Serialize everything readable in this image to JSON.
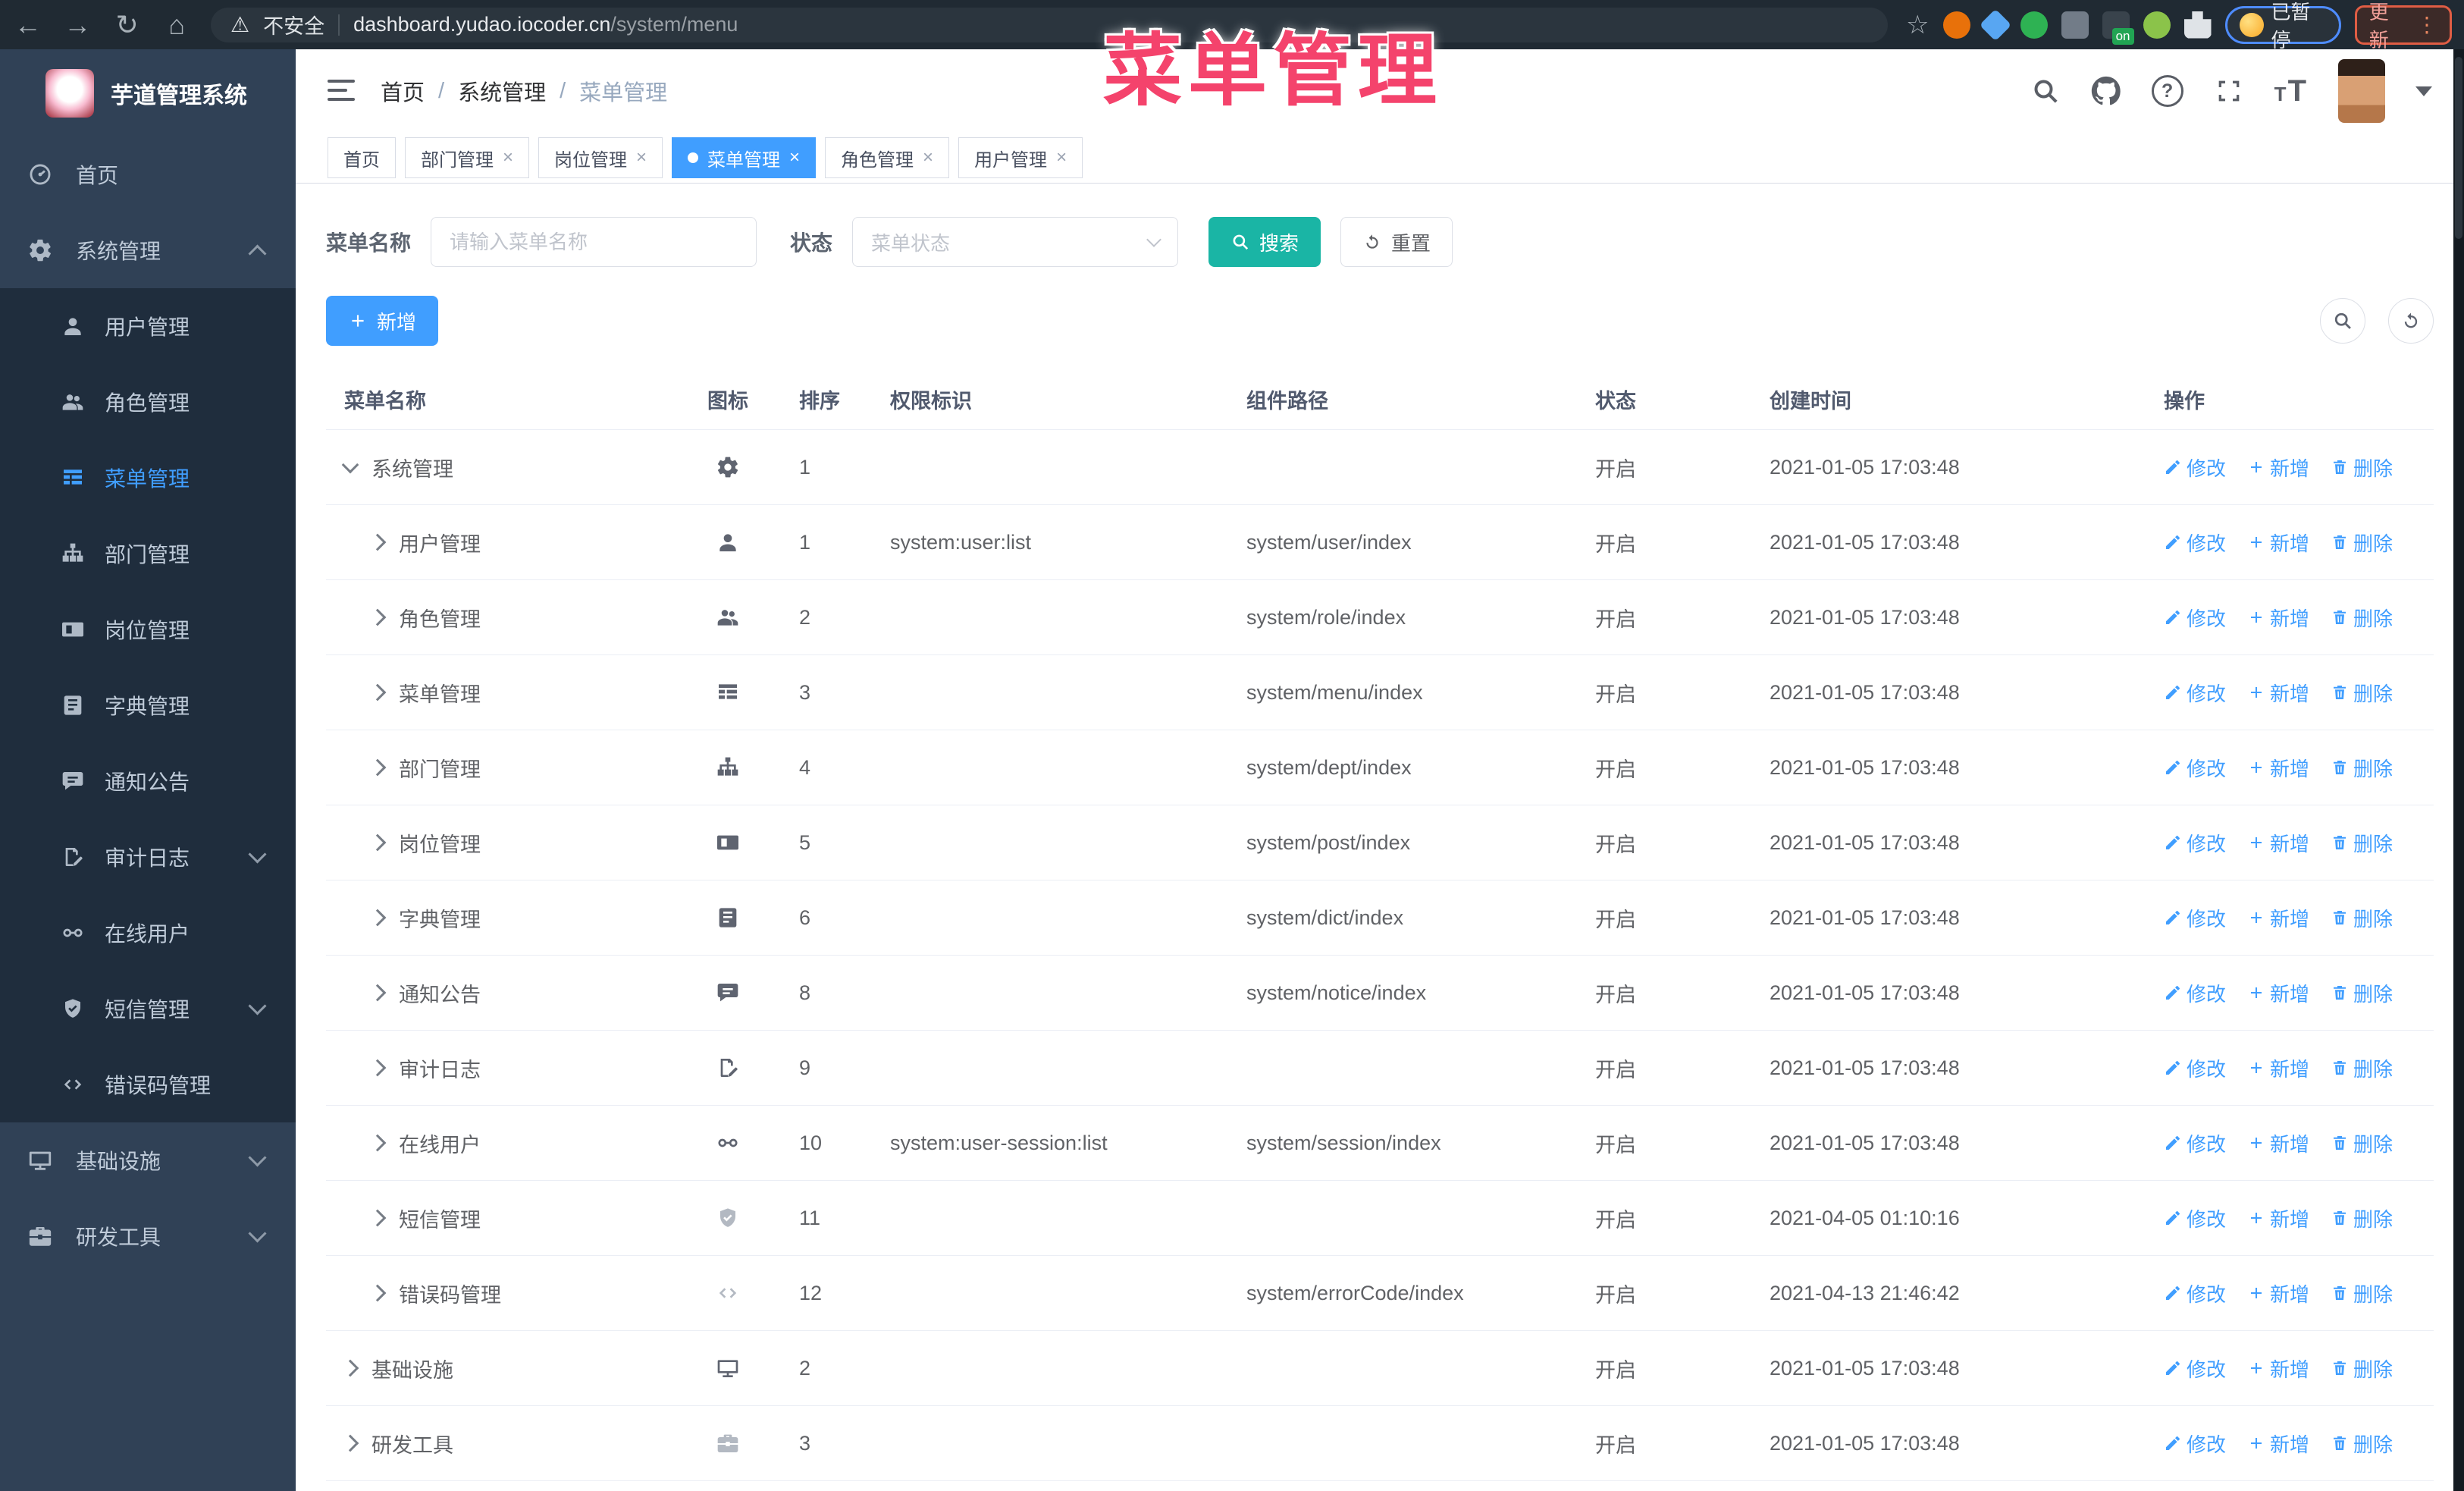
{
  "overlay": {
    "title": "菜单管理"
  },
  "colors": {
    "primary": "#409eff",
    "search_button": "#1ab5a5",
    "annotation": "#f4436c",
    "sidebar_bg": "#304156",
    "submenu_bg": "#1f2d3d",
    "tab_active": "#409eff"
  },
  "browser": {
    "security_label": "不安全",
    "url_host": "dashboard.yudao.iocoder.cn",
    "url_path": "/system/menu",
    "paused_label": "已暂停",
    "update_label": "更新",
    "extensions": [
      {
        "icon": "circle-orange",
        "shape": "c",
        "color": "#e8710a"
      },
      {
        "icon": "gem-blue",
        "shape": "d",
        "color": "#58a6f2"
      },
      {
        "icon": "circle-green-check",
        "shape": "c",
        "color": "#2eb253"
      },
      {
        "icon": "blocks-gray",
        "shape": "sq",
        "color": "#727c88"
      },
      {
        "icon": "panel-dark",
        "shape": "sq",
        "color": "#39434c",
        "badge": "on",
        "badge_color": "#21a453"
      },
      {
        "icon": "robot-green",
        "shape": "c",
        "color": "#8bc34a"
      },
      {
        "icon": "extensions-puzzle",
        "shape": "p",
        "color": "#dfe3e7"
      }
    ]
  },
  "sidebar": {
    "logo_title": "芋道管理系统",
    "items": [
      {
        "label": "首页",
        "icon": "dashboard",
        "type": "root"
      },
      {
        "label": "系统管理",
        "icon": "gear",
        "type": "root",
        "caret": "up"
      },
      {
        "label": "用户管理",
        "icon": "user",
        "type": "sub"
      },
      {
        "label": "角色管理",
        "icon": "users",
        "type": "sub"
      },
      {
        "label": "菜单管理",
        "icon": "menu",
        "type": "sub",
        "active": true
      },
      {
        "label": "部门管理",
        "icon": "tree",
        "type": "sub"
      },
      {
        "label": "岗位管理",
        "icon": "badge",
        "type": "sub"
      },
      {
        "label": "字典管理",
        "icon": "book",
        "type": "sub"
      },
      {
        "label": "通知公告",
        "icon": "chat",
        "type": "sub"
      },
      {
        "label": "审计日志",
        "icon": "edit",
        "type": "sub",
        "caret": "down"
      },
      {
        "label": "在线用户",
        "icon": "link",
        "type": "sub"
      },
      {
        "label": "短信管理",
        "icon": "shield",
        "type": "sub",
        "caret": "down"
      },
      {
        "label": "错误码管理",
        "icon": "code",
        "type": "sub"
      },
      {
        "label": "基础设施",
        "icon": "monitor",
        "type": "root",
        "caret": "down"
      },
      {
        "label": "研发工具",
        "icon": "toolbox",
        "type": "root",
        "caret": "down"
      }
    ]
  },
  "header": {
    "breadcrumb": [
      "首页",
      "系统管理",
      "菜单管理"
    ],
    "breadcrumb_separator": "/"
  },
  "tabs_close_glyph": "×",
  "tabs": [
    {
      "label": "首页",
      "closable": false,
      "active": false
    },
    {
      "label": "部门管理",
      "closable": true,
      "active": false
    },
    {
      "label": "岗位管理",
      "closable": true,
      "active": false
    },
    {
      "label": "菜单管理",
      "closable": true,
      "active": true
    },
    {
      "label": "角色管理",
      "closable": true,
      "active": false
    },
    {
      "label": "用户管理",
      "closable": true,
      "active": false
    }
  ],
  "filters": {
    "name_label": "菜单名称",
    "name_placeholder": "请输入菜单名称",
    "status_label": "状态",
    "status_placeholder": "菜单状态",
    "search_label": "搜索",
    "reset_label": "重置"
  },
  "toolbar": {
    "add_label": "新增"
  },
  "table": {
    "columns": [
      "菜单名称",
      "图标",
      "排序",
      "权限标识",
      "组件路径",
      "状态",
      "创建时间",
      "操作"
    ],
    "actions": [
      {
        "label": "修改",
        "icon": "pen"
      },
      {
        "label": "新增",
        "icon": "plus"
      },
      {
        "label": "删除",
        "icon": "trash"
      }
    ],
    "rows": [
      {
        "name": "系统管理",
        "level": 0,
        "expand": "open",
        "icon": "gear",
        "sort": "1",
        "perm": "",
        "path": "",
        "status": "开启",
        "time": "2021-01-05 17:03:48"
      },
      {
        "name": "用户管理",
        "level": 1,
        "expand": "closed",
        "icon": "user",
        "sort": "1",
        "perm": "system:user:list",
        "path": "system/user/index",
        "status": "开启",
        "time": "2021-01-05 17:03:48"
      },
      {
        "name": "角色管理",
        "level": 1,
        "expand": "closed",
        "icon": "users",
        "sort": "2",
        "perm": "",
        "path": "system/role/index",
        "status": "开启",
        "time": "2021-01-05 17:03:48"
      },
      {
        "name": "菜单管理",
        "level": 1,
        "expand": "closed",
        "icon": "menu",
        "sort": "3",
        "perm": "",
        "path": "system/menu/index",
        "status": "开启",
        "time": "2021-01-05 17:03:48"
      },
      {
        "name": "部门管理",
        "level": 1,
        "expand": "closed",
        "icon": "tree",
        "sort": "4",
        "perm": "",
        "path": "system/dept/index",
        "status": "开启",
        "time": "2021-01-05 17:03:48"
      },
      {
        "name": "岗位管理",
        "level": 1,
        "expand": "closed",
        "icon": "badge",
        "sort": "5",
        "perm": "",
        "path": "system/post/index",
        "status": "开启",
        "time": "2021-01-05 17:03:48"
      },
      {
        "name": "字典管理",
        "level": 1,
        "expand": "closed",
        "icon": "book",
        "sort": "6",
        "perm": "",
        "path": "system/dict/index",
        "status": "开启",
        "time": "2021-01-05 17:03:48"
      },
      {
        "name": "通知公告",
        "level": 1,
        "expand": "closed",
        "icon": "chat",
        "sort": "8",
        "perm": "",
        "path": "system/notice/index",
        "status": "开启",
        "time": "2021-01-05 17:03:48"
      },
      {
        "name": "审计日志",
        "level": 1,
        "expand": "closed",
        "icon": "edit",
        "sort": "9",
        "perm": "",
        "path": "",
        "status": "开启",
        "time": "2021-01-05 17:03:48"
      },
      {
        "name": "在线用户",
        "level": 1,
        "expand": "closed",
        "icon": "link",
        "sort": "10",
        "perm": "system:user-session:list",
        "path": "system/session/index",
        "status": "开启",
        "time": "2021-01-05 17:03:48"
      },
      {
        "name": "短信管理",
        "level": 1,
        "expand": "closed",
        "icon": "shield",
        "icon_muted": true,
        "sort": "11",
        "perm": "",
        "path": "",
        "status": "开启",
        "time": "2021-04-05 01:10:16"
      },
      {
        "name": "错误码管理",
        "level": 1,
        "expand": "closed",
        "icon": "code",
        "icon_muted": true,
        "sort": "12",
        "perm": "",
        "path": "system/errorCode/index",
        "status": "开启",
        "time": "2021-04-13 21:46:42"
      },
      {
        "name": "基础设施",
        "level": 0,
        "expand": "closed",
        "icon": "monitor",
        "sort": "2",
        "perm": "",
        "path": "",
        "status": "开启",
        "time": "2021-01-05 17:03:48"
      },
      {
        "name": "研发工具",
        "level": 0,
        "expand": "closed",
        "icon": "toolbox",
        "icon_muted": true,
        "sort": "3",
        "perm": "",
        "path": "",
        "status": "开启",
        "time": "2021-01-05 17:03:48"
      }
    ]
  }
}
